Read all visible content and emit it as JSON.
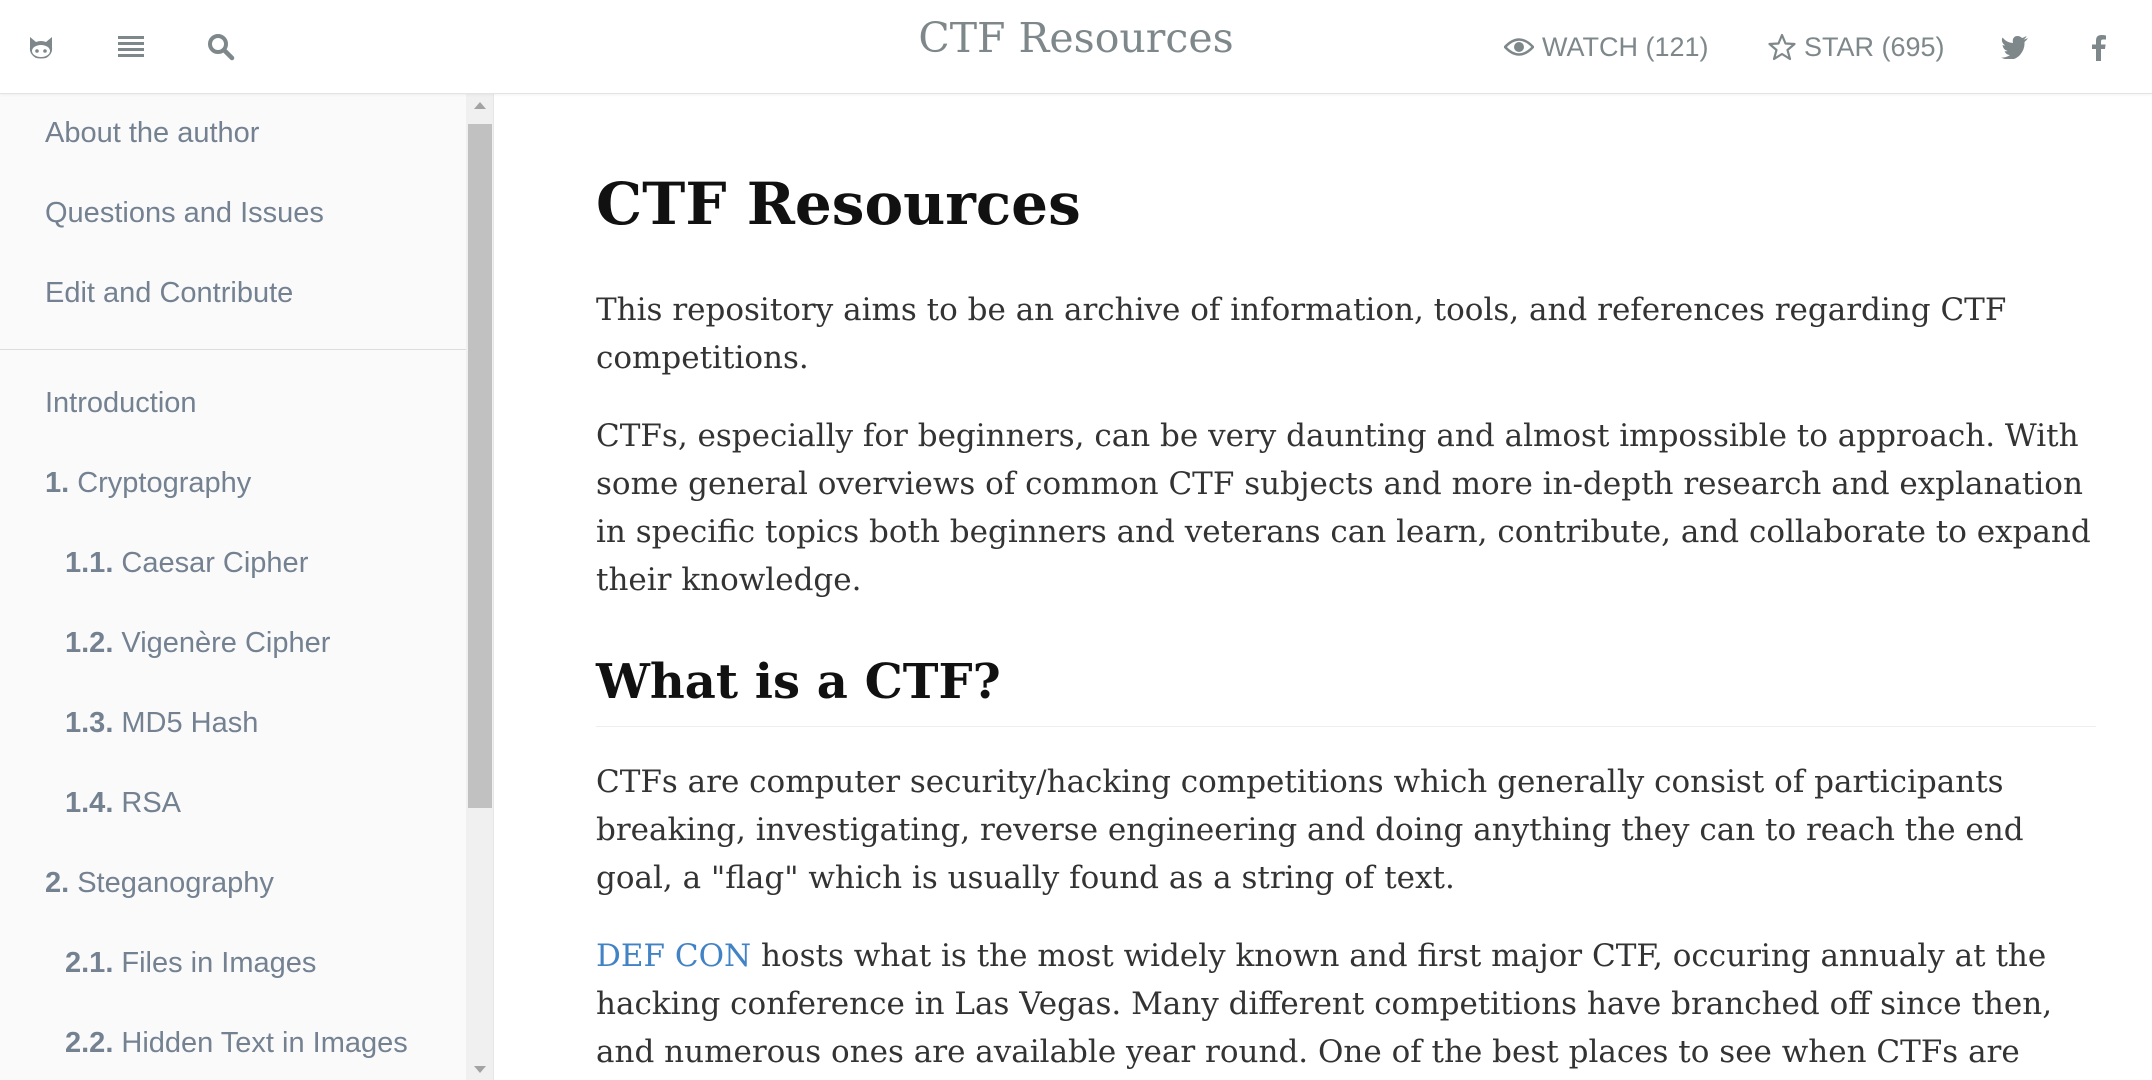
{
  "header": {
    "title": "CTF Resources",
    "watch_label": "WATCH (121)",
    "star_label": "STAR (695)",
    "icons": [
      "github-icon",
      "toc-icon",
      "search-icon",
      "eye-icon",
      "star-icon",
      "twitter-icon",
      "facebook-icon"
    ]
  },
  "sidebar": {
    "top_items": [
      {
        "label": "About the author"
      },
      {
        "label": "Questions and Issues"
      },
      {
        "label": "Edit and Contribute"
      }
    ],
    "items": [
      {
        "num": "",
        "label": "Introduction"
      },
      {
        "num": "1.",
        "label": "Cryptography"
      },
      {
        "num": "1.1.",
        "label": "Caesar Cipher"
      },
      {
        "num": "1.2.",
        "label": "Vigenère Cipher"
      },
      {
        "num": "1.3.",
        "label": "MD5 Hash"
      },
      {
        "num": "1.4.",
        "label": "RSA"
      },
      {
        "num": "2.",
        "label": "Steganography"
      },
      {
        "num": "2.1.",
        "label": "Files in Images"
      },
      {
        "num": "2.2.",
        "label": "Hidden Text in Images"
      }
    ]
  },
  "main": {
    "h1": "CTF Resources",
    "p1": "This repository aims to be an archive of information, tools, and references regarding CTF competitions.",
    "p2": "CTFs, especially for beginners, can be very daunting and almost impossible to approach. With some general overviews of common CTF subjects and more in-depth research and explanation in specific topics both beginners and veterans can learn, contribute, and collaborate to expand their knowledge.",
    "h2": "What is a CTF?",
    "p3": "CTFs are computer security/hacking competitions which generally consist of participants breaking, investigating, reverse engineering and doing anything they can to reach the end goal, a \"flag\" which is usually found as a string of text.",
    "p4_link": "DEF CON",
    "p4_text": " hosts what is the most widely known and first major CTF, occuring annualy at the hacking conference in Las Vegas. Many different competitions have branched off since then, and numerous ones are available year round. One of the best places to see when CTFs are"
  },
  "colors": {
    "link": "#4183c4",
    "sidebar_text": "#738191",
    "header_text": "#7e888b"
  }
}
